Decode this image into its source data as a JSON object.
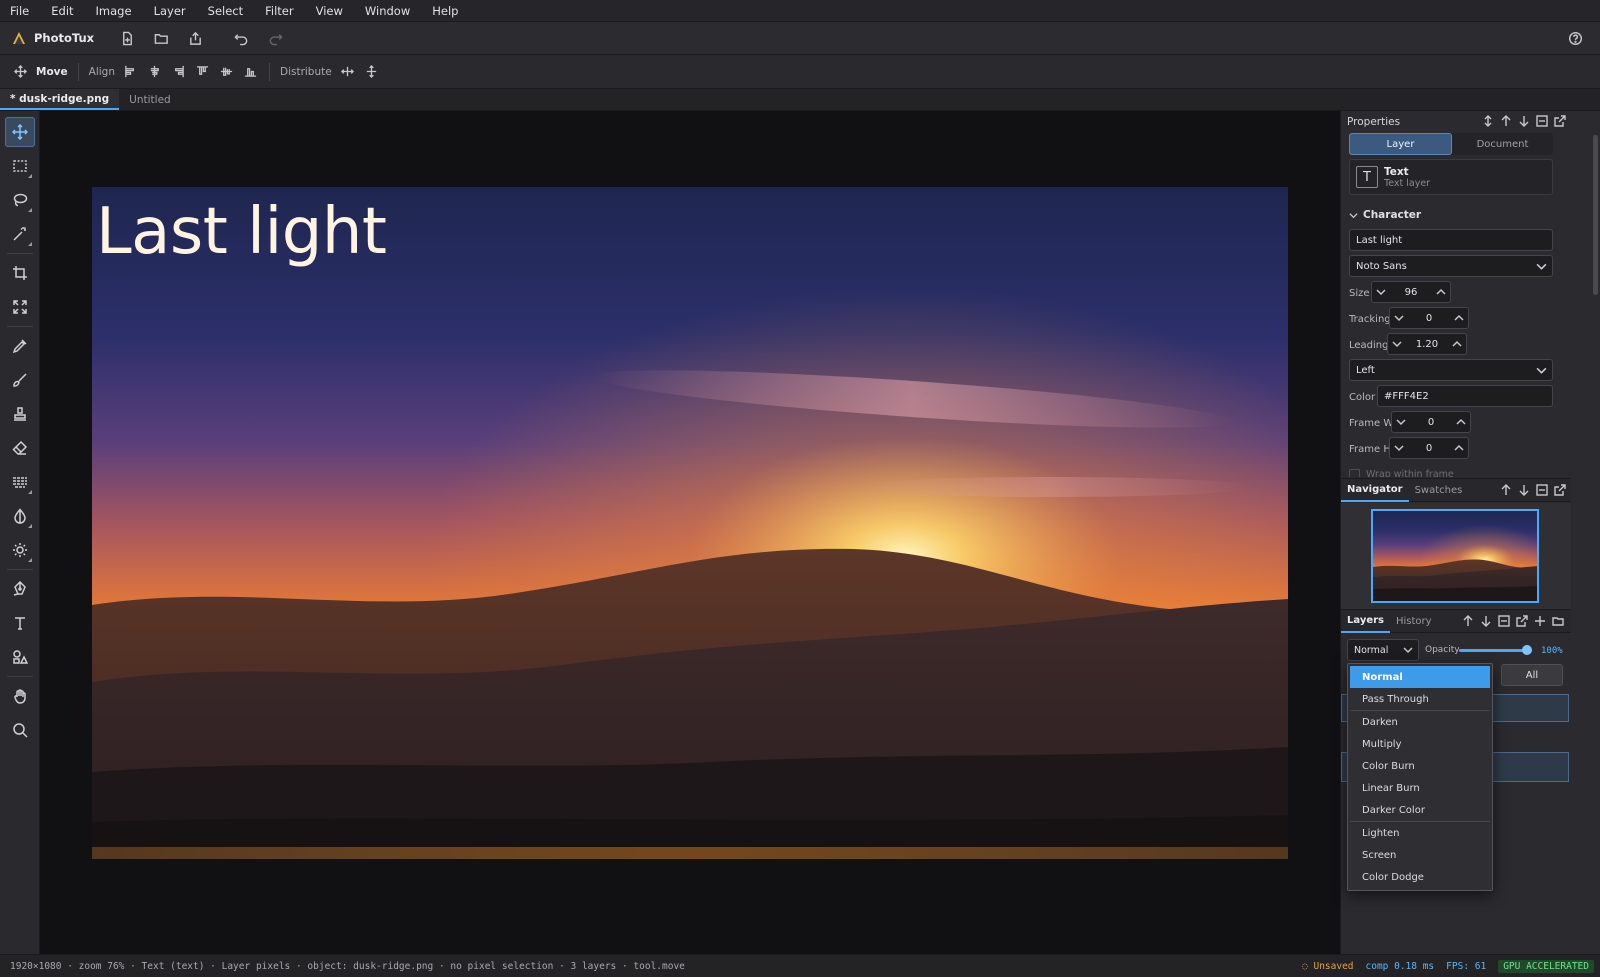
{
  "menu": [
    "File",
    "Edit",
    "Image",
    "Layer",
    "Select",
    "Filter",
    "View",
    "Window",
    "Help"
  ],
  "app": {
    "name": "PhotoTux"
  },
  "options": {
    "move": "Move",
    "align": "Align",
    "distribute": "Distribute"
  },
  "tabs": [
    {
      "label": "* dusk-ridge.png",
      "active": true
    },
    {
      "label": "Untitled",
      "active": false
    }
  ],
  "tools": [
    "move",
    "marquee",
    "lasso",
    "magic-wand",
    "crop",
    "transform",
    "eyedropper",
    "brush",
    "stamp",
    "eraser",
    "gradient",
    "dodge",
    "brightness",
    "pen",
    "type",
    "shapes",
    "hand",
    "zoom"
  ],
  "canvas": {
    "text_layer": "Last light"
  },
  "properties": {
    "title": "Properties",
    "tab_layer": "Layer",
    "tab_document": "Document",
    "layer_name": "Text",
    "layer_type": "Text layer",
    "section": "Character",
    "text_value": "Last light",
    "font": "Noto Sans",
    "size_label": "Size",
    "size": "96",
    "tracking_label": "Tracking",
    "tracking": "0",
    "leading_label": "Leading",
    "leading": "1.20",
    "align": "Left",
    "color_label": "Color",
    "color": "#FFF4E2",
    "framew_label": "Frame W",
    "framew": "0",
    "frameh_label": "Frame H",
    "frameh": "0",
    "wrap_label": "Wrap within frame"
  },
  "navigator": {
    "tab": "Navigator",
    "tab2": "Swatches"
  },
  "layers": {
    "tab": "Layers",
    "tab2": "History",
    "blend": "Normal",
    "opacity_label": "Opacity",
    "opacity": "100%",
    "opacity_value": 1.0,
    "filter_all": "All"
  },
  "blend_modes": [
    "Normal",
    "Pass Through",
    "Darken",
    "Multiply",
    "Color Burn",
    "Linear Burn",
    "Darker Color",
    "Lighten",
    "Screen",
    "Color Dodge"
  ],
  "status": {
    "info": "1920×1080 · zoom 76% · Text (text) · Layer pixels · object: dusk-ridge.png · no pixel selection · 3 layers · tool.move",
    "unsaved": "Unsaved",
    "comp": "comp 0.18 ms",
    "fps": "FPS: 61",
    "gpu": "GPU ACCELERATED"
  },
  "colors": {
    "accent": "#4aa8ff",
    "selected": "#3d9be9",
    "text_fill": "#FFF4E2"
  }
}
